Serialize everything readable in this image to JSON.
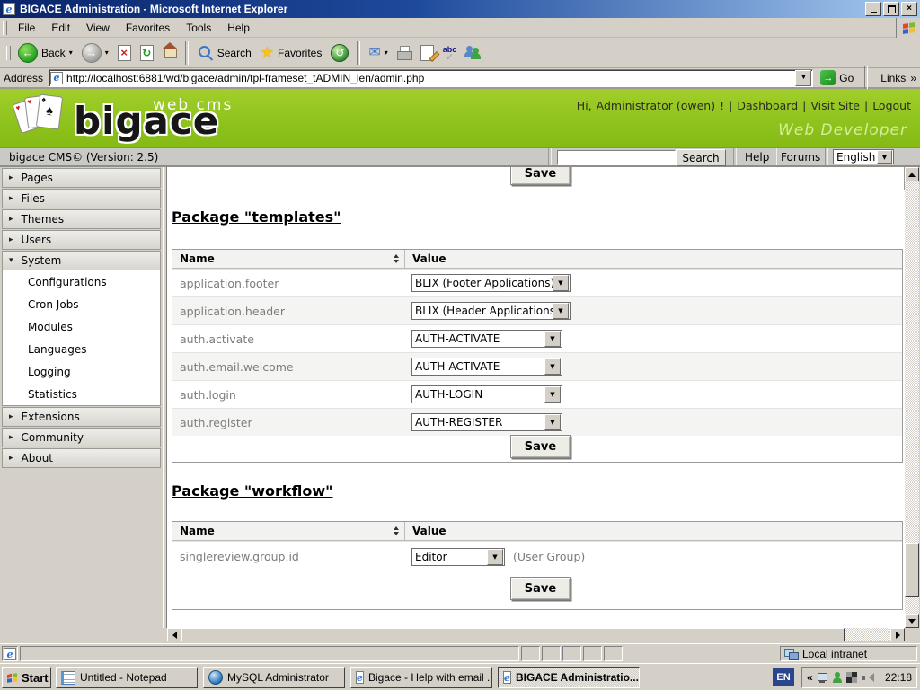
{
  "window": {
    "title": "BIGACE Administration - Microsoft Internet Explorer"
  },
  "menu": {
    "items": [
      "File",
      "Edit",
      "View",
      "Favorites",
      "Tools",
      "Help"
    ]
  },
  "toolbar": {
    "back": "Back",
    "search": "Search",
    "favorites": "Favorites"
  },
  "address": {
    "label": "Address",
    "url": "http://localhost:6881/wd/bigace/admin/tpl-frameset_tADMIN_len/admin.php",
    "go": "Go",
    "links": "Links"
  },
  "brand": {
    "tagline": "web cms",
    "logo": "bigace",
    "greeting": "Hi,",
    "user": "Administrator (owen)",
    "bang": "!",
    "sep": "|",
    "dashboard": "Dashboard",
    "visit_site": "Visit Site",
    "logout": "Logout",
    "role": "Web Developer"
  },
  "infobar": {
    "version": "bigace CMS© (Version: 2.5)",
    "search_button": "Search",
    "help": "Help",
    "forums": "Forums",
    "language": "English"
  },
  "sidebar": {
    "top": [
      "Pages",
      "Files",
      "Themes",
      "Users",
      "System"
    ],
    "system_children": [
      "Configurations",
      "Cron Jobs",
      "Modules",
      "Languages",
      "Logging",
      "Statistics"
    ],
    "bottom": [
      "Extensions",
      "Community",
      "About"
    ]
  },
  "content": {
    "top_save": "Save",
    "templates": {
      "heading": "Package \"templates\"",
      "col_name": "Name",
      "col_value": "Value",
      "rows": [
        {
          "name": "application.footer",
          "value": "BLIX (Footer Applications)"
        },
        {
          "name": "application.header",
          "value": "BLIX (Header Applications)"
        },
        {
          "name": "auth.activate",
          "value": "AUTH-ACTIVATE"
        },
        {
          "name": "auth.email.welcome",
          "value": "AUTH-ACTIVATE"
        },
        {
          "name": "auth.login",
          "value": "AUTH-LOGIN"
        },
        {
          "name": "auth.register",
          "value": "AUTH-REGISTER"
        }
      ],
      "save": "Save"
    },
    "workflow": {
      "heading": "Package \"workflow\"",
      "col_name": "Name",
      "col_value": "Value",
      "rows": [
        {
          "name": "singlereview.group.id",
          "value": "Editor",
          "note": "(User Group)"
        }
      ],
      "save": "Save"
    }
  },
  "statusbar": {
    "zone": "Local intranet"
  },
  "taskbar": {
    "start": "Start",
    "tasks": [
      "Untitled - Notepad",
      "MySQL Administrator",
      "Bigace - Help with email ...",
      "BIGACE Administratio..."
    ],
    "lang": "EN",
    "clock": "22:18"
  },
  "icons": {
    "chevron_down": "▾",
    "select_arrow": "▼",
    "close": "×",
    "arrow_left": "←",
    "arrow_right": "→",
    "refresh": "↻",
    "history": "↺",
    "star": "★",
    "mail": "✉",
    "check": "✓",
    "abc": "abc",
    "ie": "e",
    "stop": "×",
    "links_chevrons": "»",
    "tray_chevrons": "«",
    "chevron_right": "▸",
    "spade": "♠",
    "heart": "♥",
    "club": "♣"
  },
  "colors": {
    "brand_green": "#8FC31D",
    "title_bar_from": "#0A246A",
    "title_bar_to": "#A6CAF0",
    "chrome": "#D4D0C8",
    "role_text": "#D5EC9A"
  }
}
